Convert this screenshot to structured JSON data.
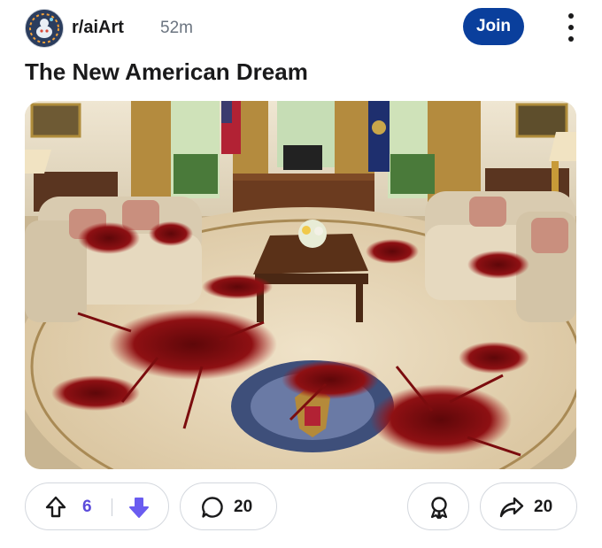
{
  "post": {
    "subreddit": "r/aiArt",
    "time_ago": "52m",
    "join_label": "Join",
    "title": "The New American Dream"
  },
  "icons": {
    "avatar": "subreddit-avatar-icon",
    "more": "more-options-icon",
    "upvote": "upvote-icon",
    "downvote": "downvote-icon",
    "comment": "comment-icon",
    "award": "award-icon",
    "share": "share-icon"
  },
  "actions": {
    "upvotes": "6",
    "comments": "20",
    "shares": "20"
  },
  "colors": {
    "join_button": "#0a3f9c",
    "vote_accent": "#5b4bdb",
    "border": "#d4d8de"
  }
}
